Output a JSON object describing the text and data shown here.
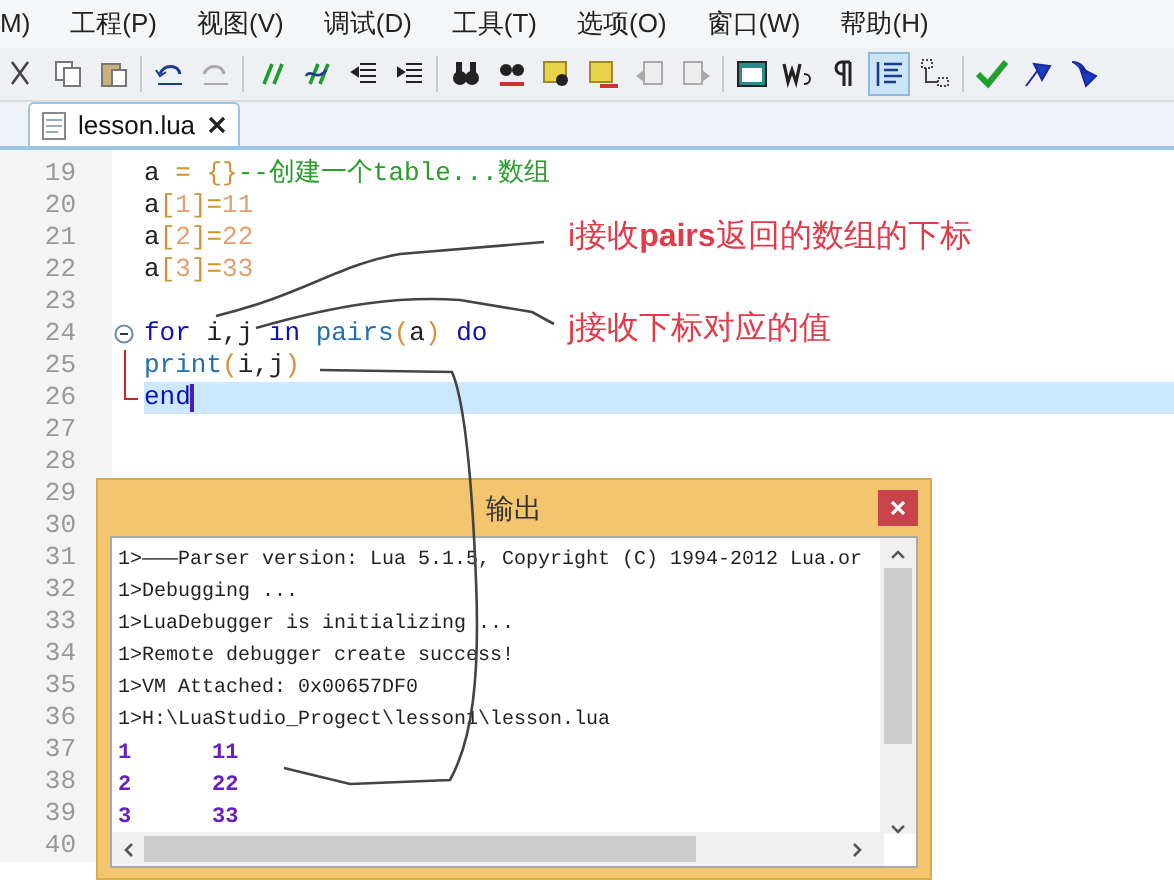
{
  "menu": [
    "M)",
    "工程(P)",
    "视图(V)",
    "调试(D)",
    "工具(T)",
    "选项(O)",
    "窗口(W)",
    "帮助(H)"
  ],
  "toolbar": {
    "buttons": [
      {
        "selected": false
      },
      {
        "selected": false
      },
      {
        "selected": false
      },
      {
        "selected": false
      },
      {
        "selected": false
      },
      {
        "selected": false
      },
      {
        "selected": false
      },
      {
        "selected": false
      },
      {
        "selected": false
      },
      {
        "selected": false
      },
      {
        "selected": false
      },
      {
        "selected": false
      },
      {
        "selected": false
      },
      {
        "selected": false
      },
      {
        "selected": false
      },
      {
        "selected": false
      },
      {
        "selected": false
      },
      {
        "selected": false
      },
      {
        "selected": true
      },
      {
        "selected": false
      },
      {
        "selected": false
      },
      {
        "selected": false
      },
      {
        "selected": false
      }
    ]
  },
  "tabs": [
    {
      "label": "lesson.lua",
      "selected": true
    }
  ],
  "editor": {
    "lines": [
      {
        "number": "19",
        "kind": "plain",
        "tokens": [
          {
            "kind": "plain",
            "text": "a "
          },
          {
            "kind": "punct",
            "text": "= {}"
          },
          {
            "kind": "comment",
            "text": "--创建一个table...数组"
          }
        ]
      },
      {
        "number": "20",
        "kind": "plain",
        "tokens": [
          {
            "kind": "plain",
            "text": "a"
          },
          {
            "kind": "punct",
            "text": "["
          },
          {
            "kind": "number",
            "text": "1"
          },
          {
            "kind": "punct",
            "text": "]="
          },
          {
            "kind": "number",
            "text": "11"
          }
        ]
      },
      {
        "number": "21",
        "kind": "plain",
        "tokens": [
          {
            "kind": "plain",
            "text": "a"
          },
          {
            "kind": "punct",
            "text": "["
          },
          {
            "kind": "number",
            "text": "2"
          },
          {
            "kind": "punct",
            "text": "]="
          },
          {
            "kind": "number",
            "text": "22"
          }
        ]
      },
      {
        "number": "22",
        "kind": "plain",
        "tokens": [
          {
            "kind": "plain",
            "text": "a"
          },
          {
            "kind": "punct",
            "text": "["
          },
          {
            "kind": "number",
            "text": "3"
          },
          {
            "kind": "punct",
            "text": "]="
          },
          {
            "kind": "number",
            "text": "33"
          }
        ]
      },
      {
        "number": "23",
        "kind": "plain"
      },
      {
        "number": "24",
        "kind": "fold_start",
        "tokens": [
          {
            "kind": "keyword",
            "text": "for"
          },
          {
            "kind": "plain",
            "text": " i,j "
          },
          {
            "kind": "keyword",
            "text": "in"
          },
          {
            "kind": "function",
            "text": " pairs"
          },
          {
            "kind": "punct",
            "text": "("
          },
          {
            "kind": "plain",
            "text": "a"
          },
          {
            "kind": "punct",
            "text": ")"
          },
          {
            "kind": "keyword",
            "text": " do"
          }
        ]
      },
      {
        "number": "25",
        "kind": "fold_body",
        "tokens": [
          {
            "kind": "function",
            "text": "print"
          },
          {
            "kind": "punct",
            "text": "("
          },
          {
            "kind": "plain",
            "text": "i,j"
          },
          {
            "kind": "punct",
            "text": ")"
          }
        ]
      },
      {
        "number": "26",
        "kind": "fold_end",
        "current": true,
        "tokens": [
          {
            "kind": "keyword",
            "text": "end"
          }
        ]
      },
      {
        "number": "27",
        "kind": "plain"
      },
      {
        "number": "28",
        "kind": "plain"
      },
      {
        "number": "29",
        "kind": "plain"
      },
      {
        "number": "30",
        "kind": "plain"
      },
      {
        "number": "31",
        "kind": "plain"
      },
      {
        "number": "32",
        "kind": "plain"
      },
      {
        "number": "33",
        "kind": "plain"
      },
      {
        "number": "34",
        "kind": "plain"
      },
      {
        "number": "35",
        "kind": "plain"
      },
      {
        "number": "36",
        "kind": "plain"
      },
      {
        "number": "37",
        "kind": "plain"
      },
      {
        "number": "38",
        "kind": "plain"
      },
      {
        "number": "39",
        "kind": "plain"
      },
      {
        "number": "40",
        "kind": "plain"
      }
    ]
  },
  "annotations": [
    "i接收**pairs**返回的数组的下标",
    "j接收下标对应的值"
  ],
  "output": {
    "title": "输出",
    "lines": [
      {
        "kind": "log",
        "text": "1>———Parser version: Lua 5.1.5, Copyright (C) 1994-2012 Lua.or"
      },
      {
        "kind": "log",
        "text": "1>Debugging ..."
      },
      {
        "kind": "log",
        "text": "1>LuaDebugger is initializing ..."
      },
      {
        "kind": "log",
        "text": "1>Remote debugger create success!"
      },
      {
        "kind": "log",
        "text": "1>VM Attached: 0x00657DF0"
      },
      {
        "kind": "log",
        "text": "1>H:\\LuaStudio_Progect\\lesson1\\lesson.lua"
      },
      {
        "kind": "result",
        "cells": [
          "1",
          "11"
        ]
      },
      {
        "kind": "result",
        "cells": [
          "2",
          "22"
        ]
      },
      {
        "kind": "result",
        "cells": [
          "3",
          "33"
        ]
      }
    ]
  }
}
